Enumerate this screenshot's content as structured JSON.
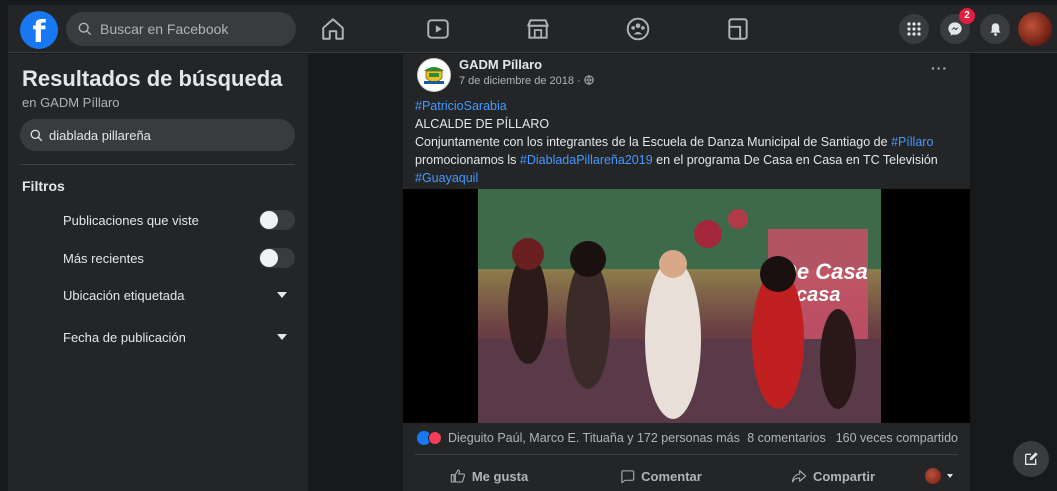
{
  "topbar": {
    "search_placeholder": "Buscar en Facebook",
    "messenger_badge": "2"
  },
  "sidebar": {
    "title": "Resultados de búsqueda",
    "subtitle": "en GADM Píllaro",
    "search_value": "diablada pillareña",
    "filters_heading": "Filtros",
    "filters": [
      {
        "label": "Publicaciones que viste",
        "control": "toggle"
      },
      {
        "label": "Más recientes",
        "control": "toggle"
      },
      {
        "label": "Ubicación etiquetada",
        "control": "dropdown"
      },
      {
        "label": "Fecha de publicación",
        "control": "dropdown"
      }
    ]
  },
  "post": {
    "author": "GADM Píllaro",
    "date": "7 de diciembre de 2018 · ",
    "more": "···",
    "hashtag1": "#PatricioSarabia",
    "line2": "ALCALDE DE PÍLLARO",
    "text_a": "Conjuntamente con los integrantes de la Escuela de Danza Municipal de Santiago de ",
    "hashtag2": "#Píllaro",
    "text_b": " promocionamos ls ",
    "hashtag3": "#DiabladaPillareña2019",
    "text_c": " en el programa De Casa en Casa en TC Televisión ",
    "hashtag4": "#Guayaquil",
    "reactions_text": "Dieguito Paúl, Marco E. Tituaña y 172 personas más",
    "comments": "8 comentarios",
    "shares": "160 veces compartido",
    "like_label": "Me gusta",
    "comment_label": "Comentar",
    "share_label": "Compartir"
  },
  "colors": {
    "accent": "#1877f2",
    "link": "#4599ff",
    "background": "#18191a",
    "surface": "#242526"
  }
}
